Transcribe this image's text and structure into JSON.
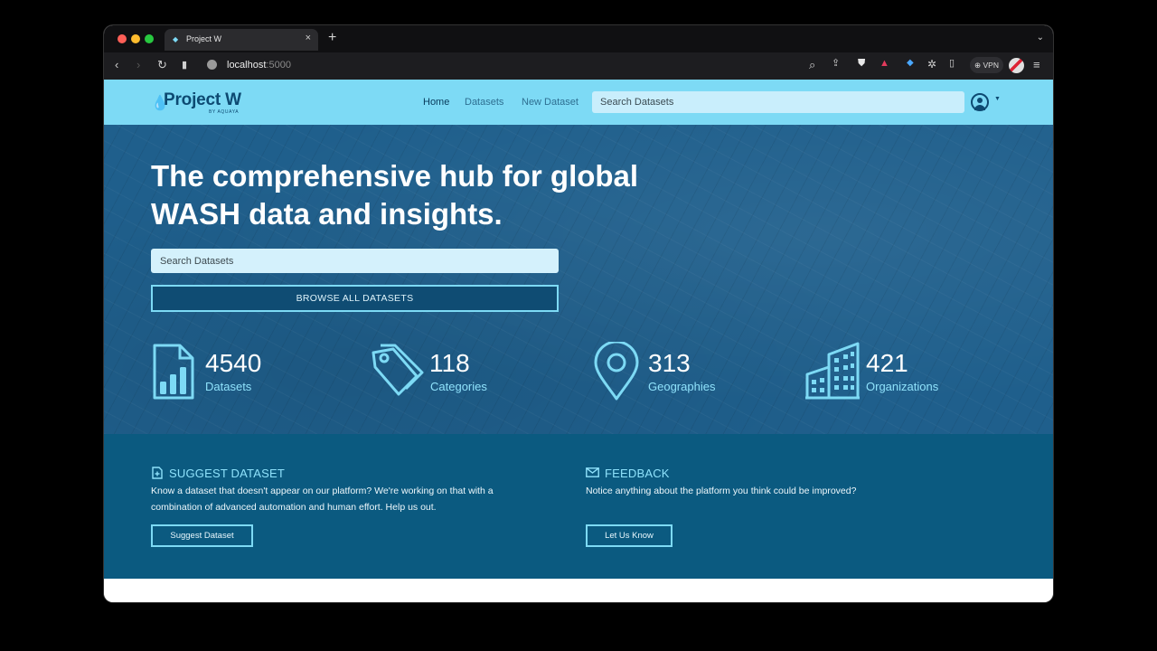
{
  "browser": {
    "tab_title": "Project W",
    "tab_close": "×",
    "new_tab": "+",
    "url_host": "localhost",
    "url_port": ":5000",
    "vpn_label": "VPN"
  },
  "header": {
    "logo": "Project W",
    "logo_sub": "BY AQUAYA",
    "nav": {
      "home": "Home",
      "datasets": "Datasets",
      "new_dataset": "New Dataset"
    },
    "search_placeholder": "Search Datasets"
  },
  "hero": {
    "title_line1": "The comprehensive hub for global",
    "title_line2": "WASH data and insights.",
    "search_placeholder": "Search Datasets",
    "browse_button": "BROWSE ALL DATASETS"
  },
  "stats": [
    {
      "value": "4540",
      "label": "Datasets",
      "icon": "bar-chart-document-icon"
    },
    {
      "value": "118",
      "label": "Categories",
      "icon": "tags-icon"
    },
    {
      "value": "313",
      "label": "Geographies",
      "icon": "map-pin-icon"
    },
    {
      "value": "421",
      "label": "Organizations",
      "icon": "buildings-icon"
    }
  ],
  "suggest": {
    "heading": "SUGGEST DATASET",
    "line1": "Know a dataset that doesn't appear on our platform? We're working on that with a",
    "line2": "combination of advanced automation and human effort. Help us out.",
    "button": "Suggest Dataset"
  },
  "feedback": {
    "heading": "FEEDBACK",
    "line1": "Notice anything about the platform you think could be improved?",
    "button": "Let Us Know"
  },
  "colors": {
    "accent": "#7ddaf5",
    "hero_bg": "#1f5f8c",
    "band_bg": "#0b5a80",
    "brand_dark": "#0d4a72"
  }
}
